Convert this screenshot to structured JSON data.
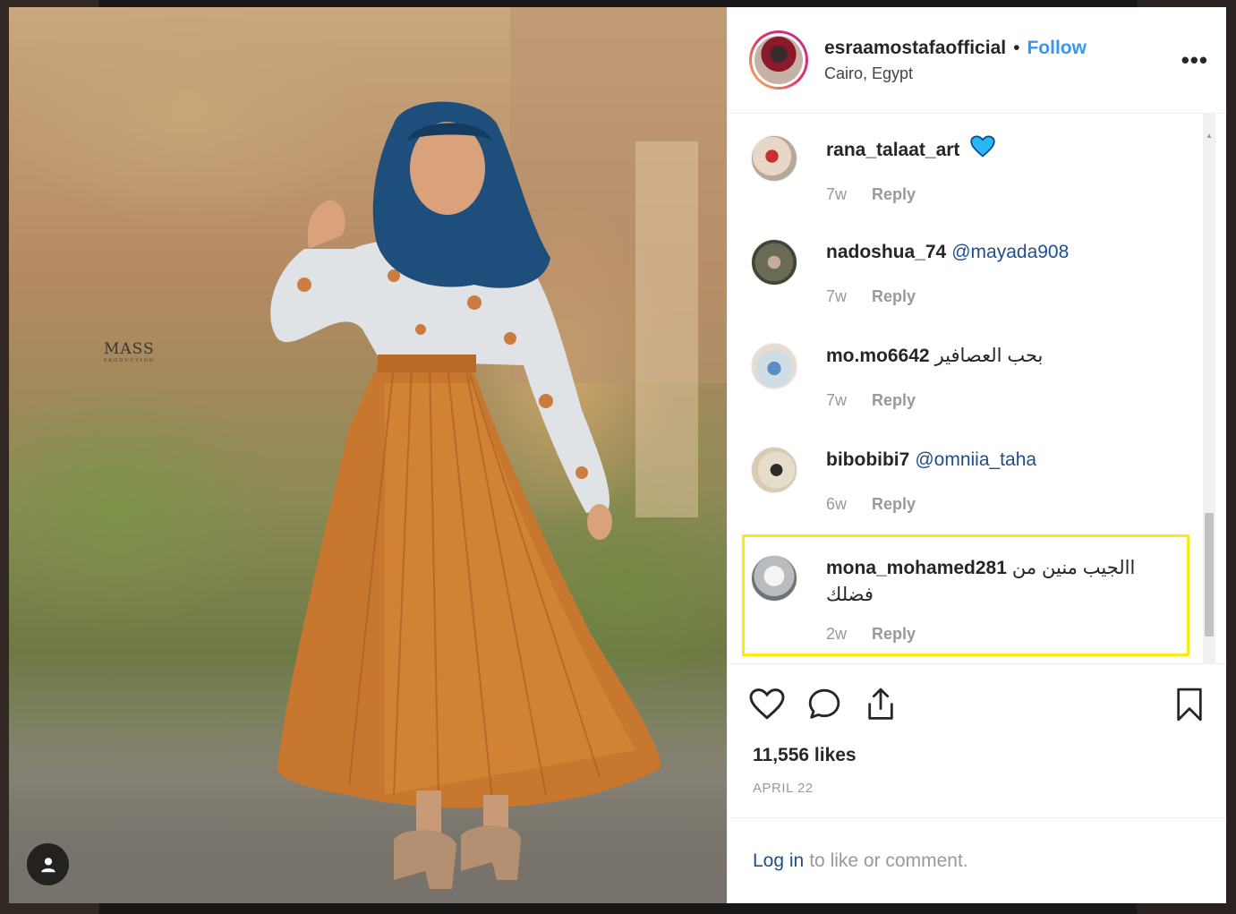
{
  "post": {
    "username": "esraamostafaofficial",
    "separator": "•",
    "follow_label": "Follow",
    "location": "Cairo, Egypt",
    "more_label": "•••",
    "watermark": "MASS",
    "watermark_sub": "PRODUCTION",
    "likes": "11,556 likes",
    "date": "APRIL 22"
  },
  "comments": [
    {
      "user": "rana_talaat_art",
      "text": "",
      "emoji": "blue-heart-icon",
      "time": "7w",
      "reply": "Reply",
      "mention": ""
    },
    {
      "user": "nadoshua_74",
      "text": "",
      "mention": "@mayada908",
      "time": "7w",
      "reply": "Reply"
    },
    {
      "user": "mo.mo6642",
      "text": "بحب العصافير",
      "mention": "",
      "time": "7w",
      "reply": "Reply"
    },
    {
      "user": "bibobibi7",
      "text": "",
      "mention": "@omniia_taha",
      "time": "6w",
      "reply": "Reply"
    },
    {
      "user": "mona_mohamed281",
      "text": "االجيب منين من فضلك",
      "mention": "",
      "time": "2w",
      "reply": "Reply"
    }
  ],
  "footer": {
    "login_link": "Log in",
    "login_rest": "to like or comment."
  },
  "colors": {
    "link_blue": "#3897f0",
    "mention_blue": "#1e4f8c",
    "highlight": "#f7ea15"
  }
}
